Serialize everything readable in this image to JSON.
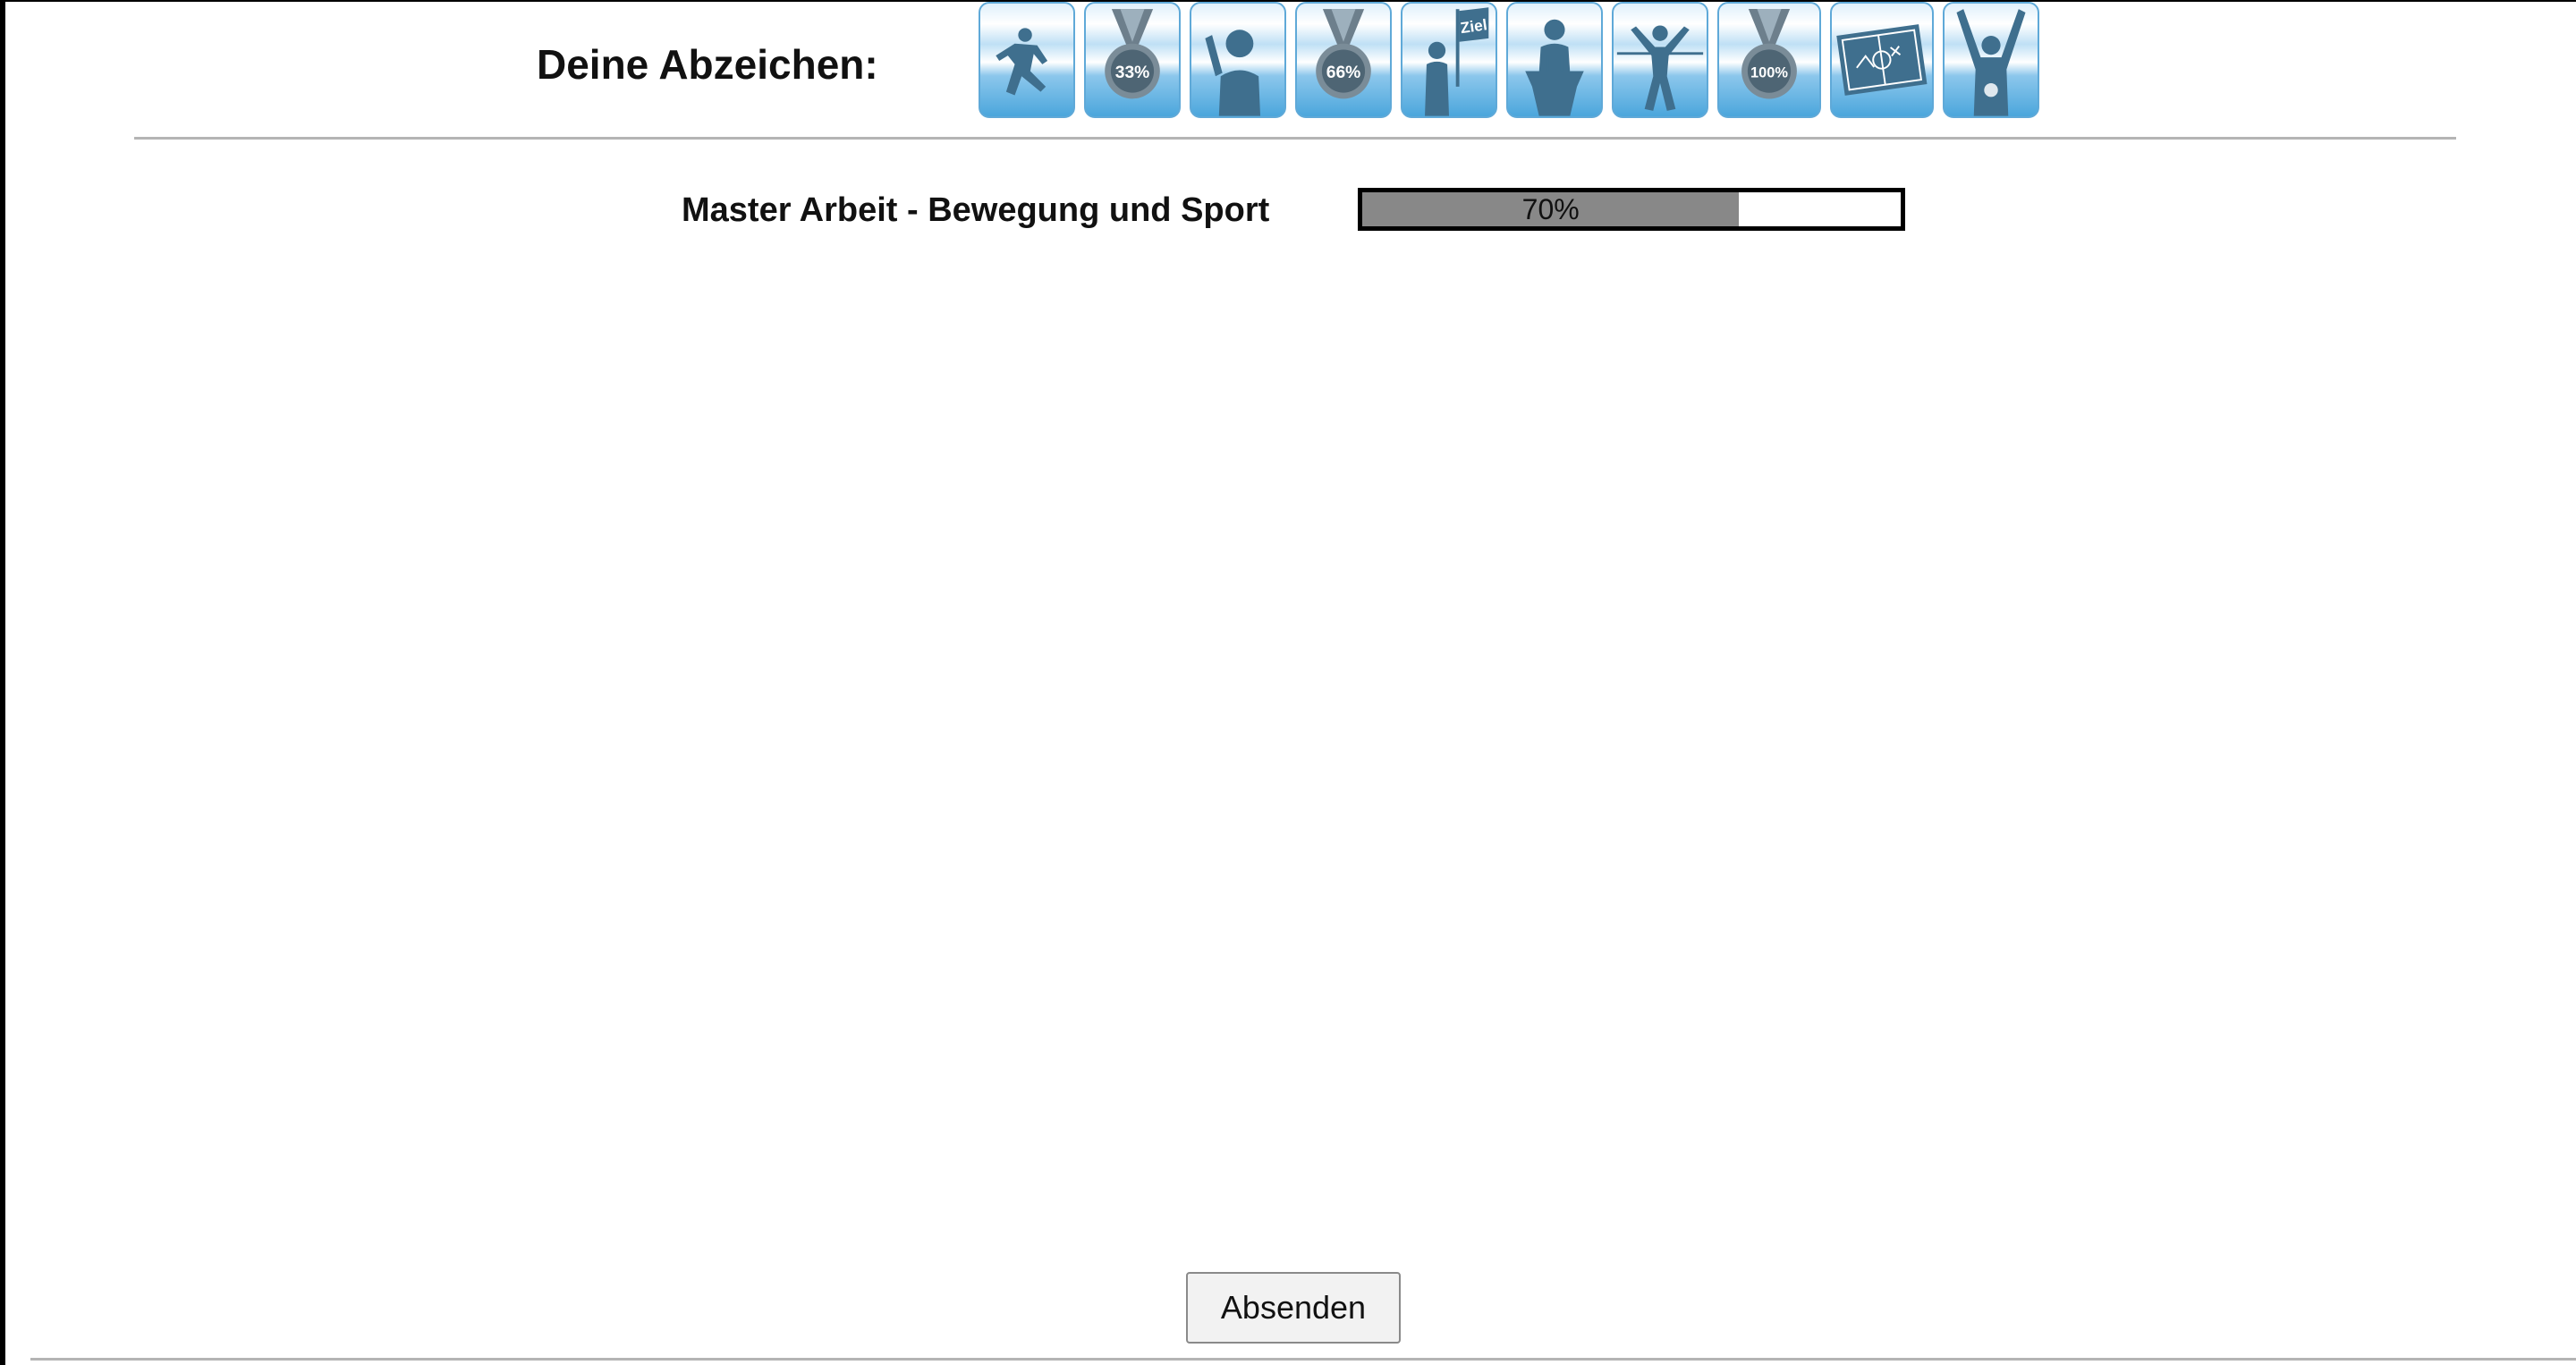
{
  "header": {
    "badges_title": "Deine Abzeichen:"
  },
  "badges": [
    {
      "icon": "runner-start-icon"
    },
    {
      "icon": "medal-icon",
      "label": "33%"
    },
    {
      "icon": "waving-person-icon"
    },
    {
      "icon": "medal-icon",
      "label": "66%"
    },
    {
      "icon": "finish-flag-person-icon",
      "label": "Ziel"
    },
    {
      "icon": "speaker-podium-icon"
    },
    {
      "icon": "finish-line-runner-icon"
    },
    {
      "icon": "medal-icon",
      "label": "100%"
    },
    {
      "icon": "tactics-board-icon"
    },
    {
      "icon": "winner-cheering-icon"
    }
  ],
  "project": {
    "label": "Master Arbeit - Bewegung und Sport",
    "progress_percent": 70,
    "progress_text": "70%"
  },
  "footer": {
    "submit_label": "Absenden"
  },
  "colors": {
    "badge_light": "#dff0fb",
    "badge_dark": "#4ba6dc",
    "silhouette": "#3f6f8e",
    "progress_fill": "#888888",
    "divider": "#b4b4b4"
  }
}
